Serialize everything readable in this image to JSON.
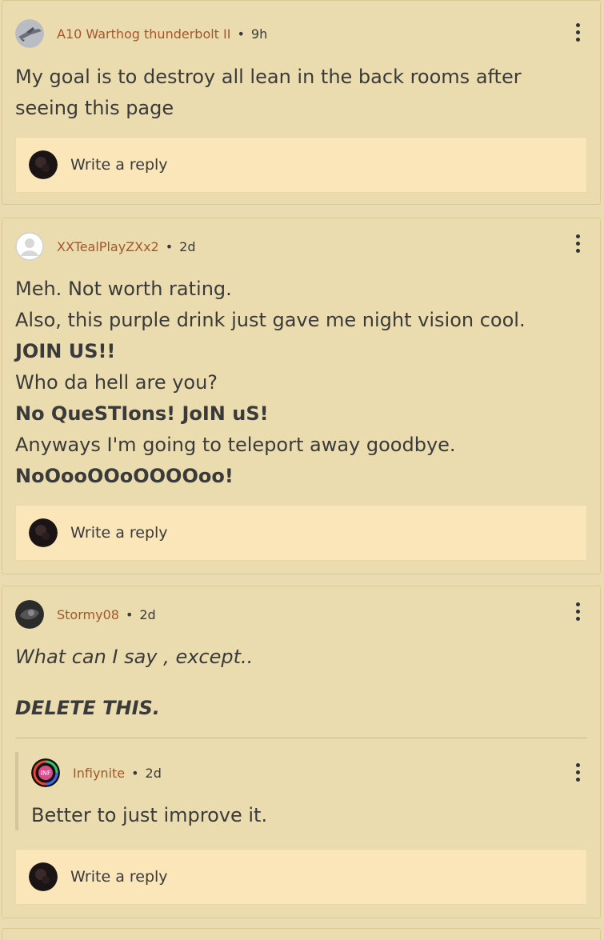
{
  "comments": [
    {
      "author": "A10 Warthog thunderbolt II",
      "separator": "•",
      "time": "9h",
      "lines": [
        "My goal is to destroy all lean in the back rooms after",
        "seeing this page"
      ],
      "reply_label": "Write a reply"
    },
    {
      "author": "XXTealPlayZXx2",
      "separator": "•",
      "time": "2d",
      "lines": [
        "Meh. Not worth rating.",
        "Also, this purple drink just gave me night vision cool.",
        "JOIN US!!",
        "Who da hell are you?",
        "No QueSTIons! JoIN uS!",
        "Anyways I'm going to teleport away goodbye.",
        "NoOooOOoOOOOoo!"
      ],
      "reply_label": "Write a reply"
    },
    {
      "author": "Stormy08",
      "separator": "•",
      "time": "2d",
      "lines": [
        "What can I say , except..",
        "DELETE THIS."
      ],
      "reply": {
        "author": "Infiynite",
        "separator": "•",
        "time": "2d",
        "text": "Better to just improve it."
      },
      "reply_label": "Write a reply"
    }
  ],
  "icons": {
    "more": "more-vertical-icon"
  },
  "colors": {
    "page_bg": "#eadcb0",
    "card_bg": "#ebdcaf",
    "reply_box_bg": "#fbe6b9",
    "author": "#a4562b",
    "text": "#3a3a3a"
  }
}
